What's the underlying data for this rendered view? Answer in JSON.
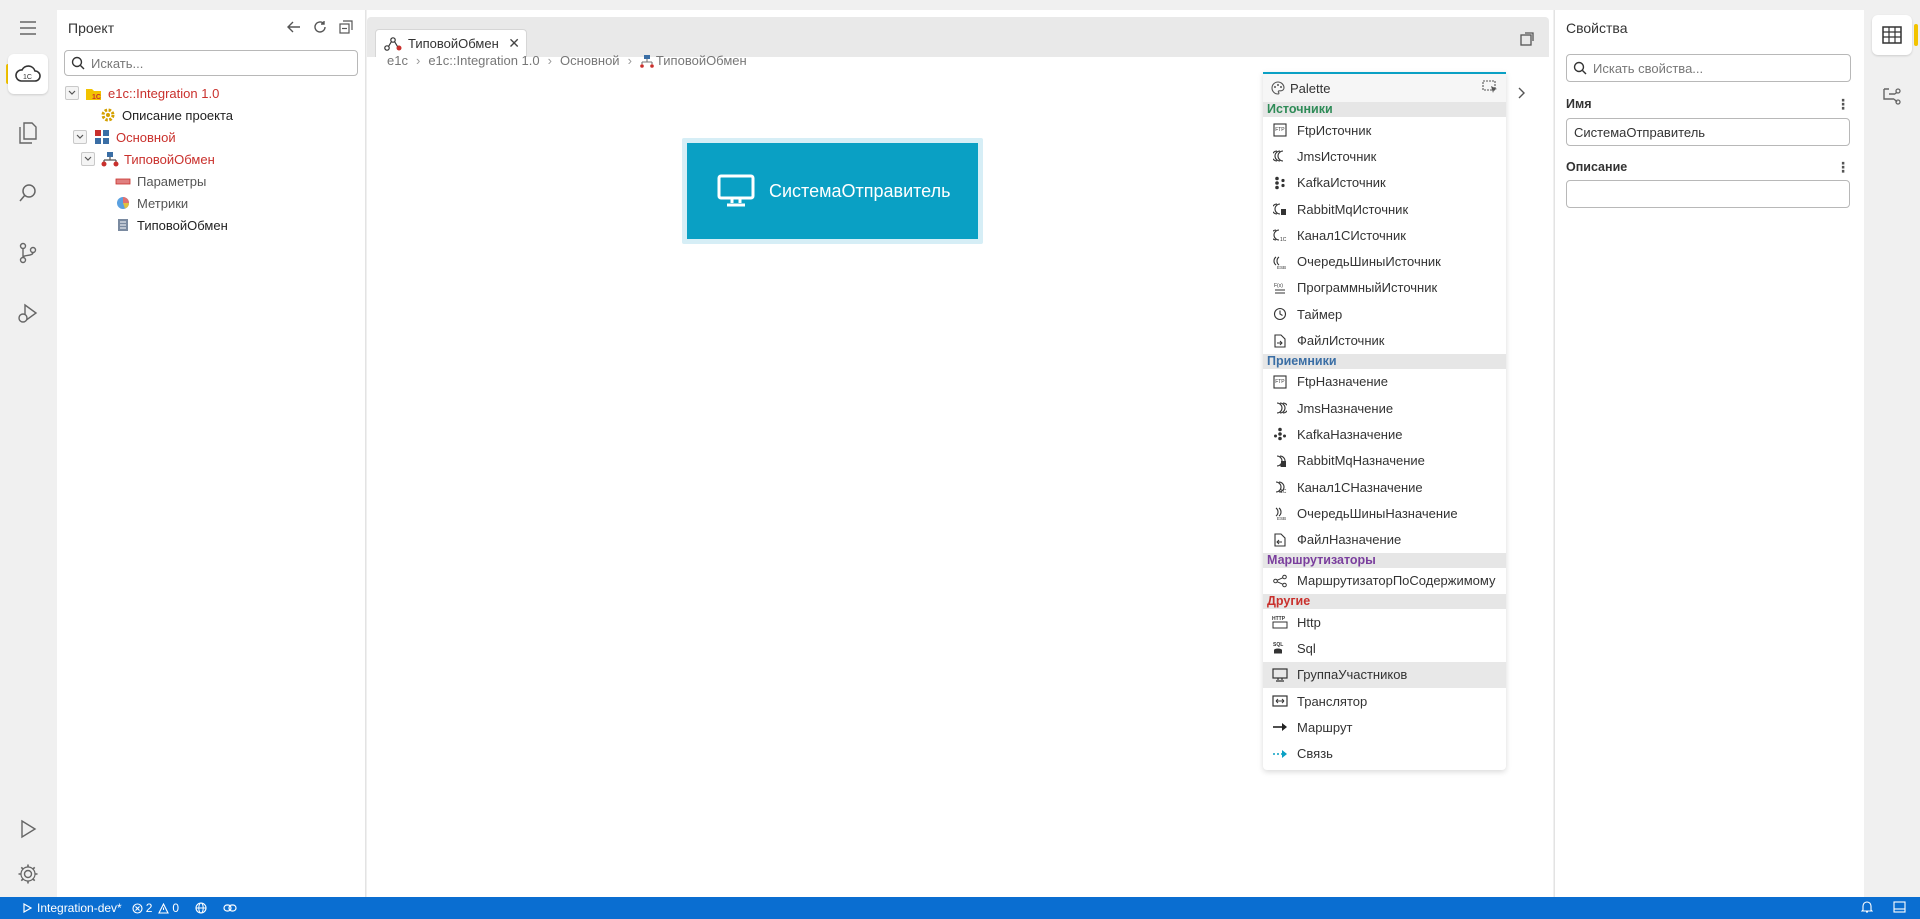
{
  "project_panel": {
    "title": "Проект",
    "search_placeholder": "Искать...",
    "tree": [
      {
        "label": "e1c::Integration 1.0",
        "color": "#c9302c"
      },
      {
        "label": "Описание проекта",
        "color": "#222222"
      },
      {
        "label": "Основной",
        "color": "#c9302c"
      },
      {
        "label": "ТиповойОбмен",
        "color": "#c9302c"
      },
      {
        "label": "Параметры",
        "color": "#555555"
      },
      {
        "label": "Метрики",
        "color": "#555555"
      },
      {
        "label": "ТиповойОбмен",
        "color": "#222222"
      }
    ]
  },
  "editor": {
    "tab_label": "ТиповойОбмен",
    "breadcrumb": [
      "e1c",
      "e1c::Integration 1.0",
      "Основной",
      "ТиповойОбмен"
    ],
    "node_label": "СистемаОтправитель",
    "node_icon": "monitor-icon"
  },
  "palette": {
    "title": "Palette",
    "sections": [
      {
        "label": "Источники",
        "color": "#2e8b57",
        "items": [
          "FtpИсточник",
          "JmsИсточник",
          "KafkaИсточник",
          "RabbitMqИсточник",
          "Канал1СИсточник",
          "ОчередьШиныИсточник",
          "ПрограммныйИсточник",
          "Таймер",
          "ФайлИсточник"
        ]
      },
      {
        "label": "Приемники",
        "color": "#3a6ea5",
        "items": [
          "FtpНазначение",
          "JmsНазначение",
          "KafkaНазначение",
          "RabbitMqНазначение",
          "Канал1СНазначение",
          "ОчередьШиныНазначение",
          "ФайлНазначение"
        ]
      },
      {
        "label": "Маршрутизаторы",
        "color": "#7a3e9d",
        "items": [
          "МаршрутизаторПоСодержимому"
        ]
      },
      {
        "label": "Другие",
        "color": "#c9302c",
        "items": [
          "Http",
          "Sql",
          "ГруппаУчастников",
          "Транслятор",
          "Маршрут",
          "Связь"
        ]
      }
    ],
    "hovered_item": "ГруппаУчастников"
  },
  "properties": {
    "title": "Свойства",
    "search_placeholder": "Искать свойства...",
    "name_label": "Имя",
    "name_value": "СистемаОтправитель",
    "description_label": "Описание",
    "description_value": ""
  },
  "status_bar": {
    "branch": "Integration-dev*",
    "errors": "2",
    "warnings": "0",
    "color": "#0a6ed1"
  },
  "colors": {
    "accent": "#0aa0c4",
    "active_marker": "#f2c300"
  }
}
